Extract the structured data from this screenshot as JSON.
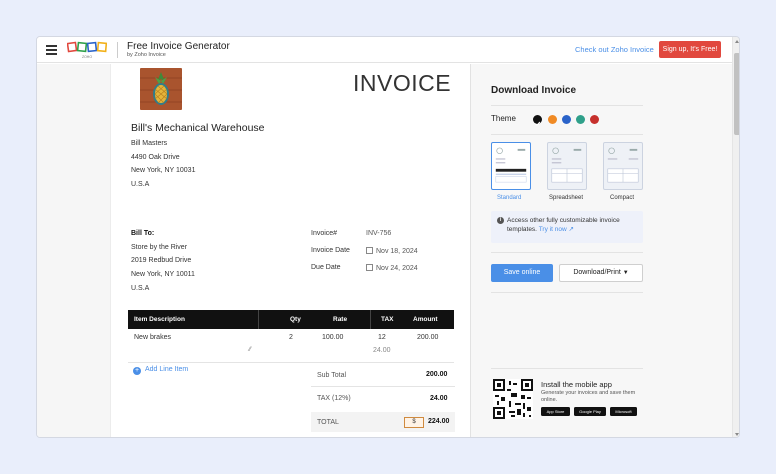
{
  "topbar": {
    "title": "Free Invoice Generator",
    "subtitle": "by Zoho Invoice",
    "logo_text": "ZOHO",
    "checkout_link": "Check out Zoho Invoice",
    "signup_button": "Sign up, It's Free!"
  },
  "invoice": {
    "heading": "INVOICE",
    "company_name": "Bill's Mechanical Warehouse",
    "from_lines": [
      "Bill Masters",
      "4490 Oak Drive",
      "New York, NY 10031",
      "U.S.A"
    ],
    "bill_to_label": "Bill To:",
    "bill_to_lines": [
      "Store by the River",
      "2019 Redbud Drive",
      "New York, NY 10011",
      "U.S.A"
    ],
    "invoice_no_label": "Invoice#",
    "invoice_no": "INV-756",
    "invoice_date_label": "Invoice Date",
    "invoice_date": "Nov 18, 2024",
    "due_date_label": "Due Date",
    "due_date": "Nov 24, 2024"
  },
  "table": {
    "columns": [
      "Item Description",
      "Qty",
      "Rate",
      "TAX",
      "Amount"
    ],
    "rows": [
      {
        "description": "New brakes",
        "qty": "2",
        "rate": "100.00",
        "tax": "12",
        "tax_amount": "24.00",
        "amount": "200.00"
      }
    ],
    "add_line_item": "Add Line Item"
  },
  "totals": {
    "subtotal_label": "Sub Total",
    "subtotal": "200.00",
    "tax_label": "TAX (12%)",
    "tax": "24.00",
    "total_label": "TOTAL",
    "currency_symbol": "$",
    "total": "224.00"
  },
  "panel": {
    "title": "Download Invoice",
    "theme_label": "Theme",
    "theme_colors": [
      "#111111",
      "#f08a24",
      "#2a63c9",
      "#2fa08a",
      "#c6302c"
    ],
    "templates": [
      "Standard",
      "Spreadsheet",
      "Compact"
    ],
    "selected_template": "Standard",
    "info_text": "Access other fully customizable invoice templates.",
    "try_link": "Try it now",
    "save_button": "Save online",
    "download_button": "Download/Print",
    "mobile_title": "Install the mobile app",
    "mobile_desc": "Generate your invoices and save them online.",
    "stores": [
      "App Store",
      "Google Play",
      "Microsoft"
    ]
  },
  "colors": {
    "accent": "#4a8fe7",
    "signup": "#e1483e",
    "table_header": "#111111"
  }
}
